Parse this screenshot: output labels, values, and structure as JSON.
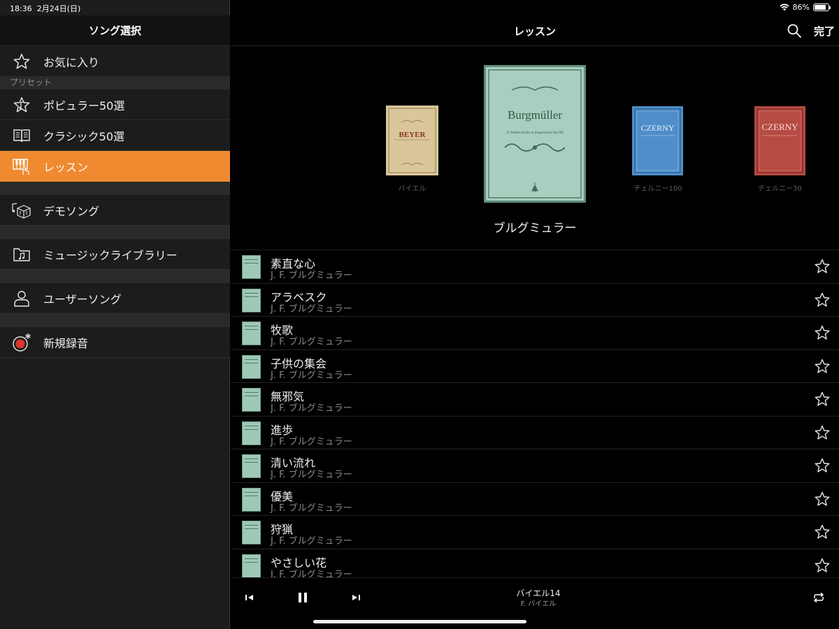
{
  "status_bar": {
    "time": "18:36",
    "date": "2月24日(日)",
    "battery_percent": "86%",
    "battery_level": 0.86
  },
  "sidebar": {
    "title": "ソング選択",
    "favorites": "お気に入り",
    "section_preset": "プリセット",
    "popular": "ポピュラー50選",
    "classic": "クラシック50選",
    "lesson": "レッスン",
    "demo": "デモソング",
    "music_library": "ミュージックライブラリー",
    "user_songs": "ユーザーソング",
    "new_recording": "新規録音"
  },
  "header": {
    "title": "レッスン",
    "done": "完了"
  },
  "carousel": {
    "books": [
      {
        "caption": "バイエル",
        "cover_text": "BEYER",
        "color": "#d9c69a"
      },
      {
        "caption": "",
        "cover_text": "Burgmüller",
        "cover_subtitle": "25 Etudes faciles et progressives Op.100",
        "color": "#a9cdbe"
      },
      {
        "caption": "チェルニー100",
        "cover_text": "CZERNY",
        "color": "#4f8ec9"
      },
      {
        "caption": "チェルニー30",
        "cover_text": "CZERNY",
        "color": "#b54b43"
      }
    ],
    "selected_title": "ブルグミュラー"
  },
  "songs": [
    {
      "title": "素直な心",
      "artist": "J. F. ブルグミュラー"
    },
    {
      "title": "アラベスク",
      "artist": "J. F. ブルグミュラー"
    },
    {
      "title": "牧歌",
      "artist": "J. F. ブルグミュラー"
    },
    {
      "title": "子供の集会",
      "artist": "J. F. ブルグミュラー"
    },
    {
      "title": "無邪気",
      "artist": "J. F. ブルグミュラー"
    },
    {
      "title": "進歩",
      "artist": "J. F. ブルグミュラー"
    },
    {
      "title": "清い流れ",
      "artist": "J. F. ブルグミュラー"
    },
    {
      "title": "優美",
      "artist": "J. F. ブルグミュラー"
    },
    {
      "title": "狩猟",
      "artist": "J. F. ブルグミュラー"
    },
    {
      "title": "やさしい花",
      "artist": "J. F. ブルグミュラー"
    }
  ],
  "player": {
    "now_playing_title": "バイエル14",
    "now_playing_artist": "F. バイエル"
  },
  "colors": {
    "accent": "#ef8a30",
    "record_red": "#e0332c"
  }
}
